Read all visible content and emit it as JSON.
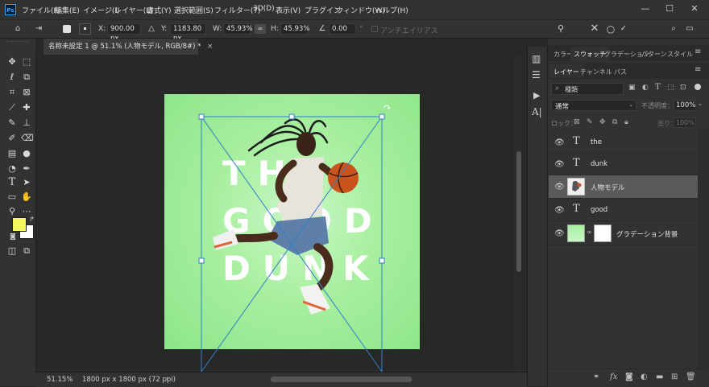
{
  "app": {
    "logo_text": "Ps"
  },
  "menu": [
    "ファイル(F)",
    "編集(E)",
    "イメージ(I)",
    "レイヤー(L)",
    "書式(Y)",
    "選択範囲(S)",
    "フィルター(T)",
    "3D(D)",
    "表示(V)",
    "プラグイン",
    "ウィンドウ(W)",
    "ヘルプ(H)"
  ],
  "window_controls": {
    "minimize": "—",
    "maximize": "☐",
    "close": "✕"
  },
  "options": {
    "x_label": "X:",
    "x_value": "900.00 px",
    "y_label": "Y:",
    "y_value": "1183.80 px",
    "w_label": "W:",
    "w_value": "45.93%",
    "h_label": "H:",
    "h_value": "45.93%",
    "angle_value": "0.00",
    "degree": "°",
    "antialias_label": "アンチエイリアス",
    "share_label": "共有"
  },
  "document_tab": {
    "title": "名称未設定 1 @ 51.1% (人物モデル, RGB/8#) *",
    "close": "×"
  },
  "artwork": {
    "line1": "THE",
    "line2": "GOOD",
    "line3": "DUNK"
  },
  "status": {
    "zoom": "51.15%",
    "doc_info": "1800 px x 1800 px (72 ppi)",
    "arrow": "›"
  },
  "panel_tabs_top": [
    "カラー",
    "スウォッチ",
    "グラデーション",
    "パターン",
    "スタイル"
  ],
  "panel_tabs_layers": [
    "レイヤー",
    "チャンネル",
    "パス"
  ],
  "layers_panel": {
    "filter_placeholder": "種類",
    "blend_mode": "通常",
    "opacity_label": "不透明度：",
    "opacity_value": "100%",
    "lock_label": "ロック：",
    "fill_label": "塗り：",
    "fill_value": "100%"
  },
  "layers": [
    {
      "name": "the",
      "type": "text",
      "selected": false
    },
    {
      "name": "dunk",
      "type": "text",
      "selected": false
    },
    {
      "name": "人物モデル",
      "type": "image",
      "selected": true
    },
    {
      "name": "good",
      "type": "text",
      "selected": false
    },
    {
      "name": "グラデーション背景",
      "type": "gradient",
      "selected": false
    }
  ],
  "colors": {
    "foreground": "#f7f75e",
    "background": "#ffffff",
    "accent": "#1473e6",
    "transform_line": "#2f7fc8",
    "artboard_green": "#a7ef9f"
  }
}
